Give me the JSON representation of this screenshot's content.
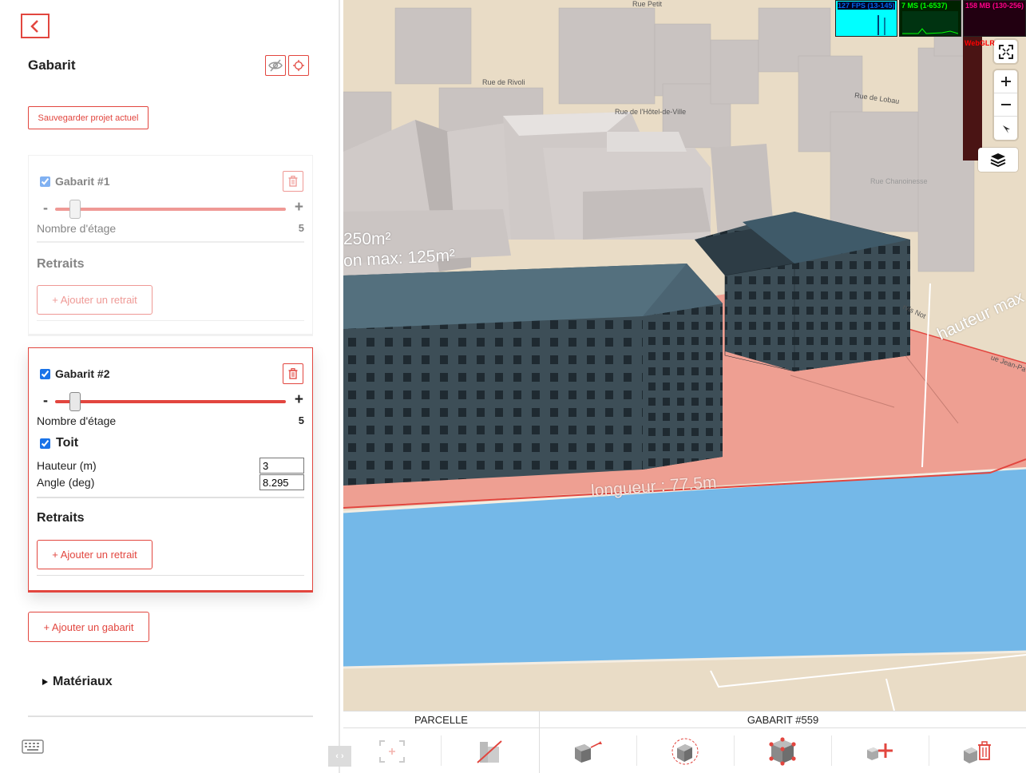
{
  "panel": {
    "title": "Gabarit",
    "save_label": "Sauvegarder projet actuel"
  },
  "gabarits": [
    {
      "title": "Gabarit #1",
      "checked": true,
      "floors_label": "Nombre d'étage",
      "floors_value": "5",
      "slider_value": 5,
      "retraits_title": "Retraits",
      "add_retrait_label": "+ Ajouter un retrait"
    },
    {
      "title": "Gabarit #2",
      "checked": true,
      "floors_label": "Nombre d'étage",
      "floors_value": "5",
      "slider_value": 5,
      "toit_label": "Toit",
      "toit_checked": true,
      "hauteur_label": "Hauteur (m)",
      "hauteur_value": "3",
      "angle_label": "Angle (deg)",
      "angle_value": "8.295",
      "retraits_title": "Retraits",
      "add_retrait_label": "+ Ajouter un retrait"
    }
  ],
  "add_gabarit_label": "+ Ajouter un gabarit",
  "materiaux_label": "Matériaux",
  "slider": {
    "minus": "-",
    "plus": "+"
  },
  "toggle_label": "‹ ›",
  "map": {
    "stats": {
      "fps": "127 FPS (13-145)",
      "ms": "7 MS (1-6537)",
      "mb": "158 MB (130-256)",
      "webgl": "WebGLR"
    },
    "labels": {
      "rue_rivoli": "Rue de Rivoli",
      "rue_hotel_ville": "Rue de l'Hôtel-de-Ville",
      "rue_lobau": "Rue de Lobau",
      "rue_petit": "Rue Petit",
      "rue_chanoinesse": "Rue Chanoinesse",
      "rue_jean": "ue Jean-Pa",
      "parvis": "rvis Not",
      "area1": "250m²",
      "area2": "on max: 125m²",
      "longueur": "longueur : 77.5m",
      "hauteur": "hauteur max"
    }
  },
  "toolbar": {
    "parcelle": "PARCELLE",
    "gabarit": "GABARIT #559"
  },
  "colors": {
    "accent": "#e2463f",
    "water": "#74b8e8",
    "parcel": "#ee9f92",
    "building_dark": "#3b4c55",
    "building_light": "#c8c2c0"
  }
}
